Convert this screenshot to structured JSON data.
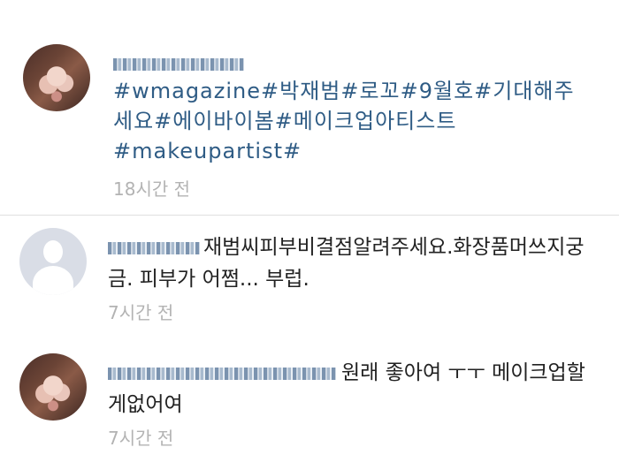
{
  "post": {
    "caption": "#wmagazine#박재범#로꼬#9월호#기대해주세요#에이바이봄#메이크업아티스트#makeupartist#",
    "time": "18시간 전"
  },
  "comments": [
    {
      "text": "재범씨피부비결점알려주세요.화장품머쓰지궁금. 피부가 어쩜... 부럽.",
      "time": "7시간 전"
    },
    {
      "text": "원래 좋아여 ㅜㅜ 메이크업할게없어여",
      "time": "7시간 전"
    }
  ]
}
